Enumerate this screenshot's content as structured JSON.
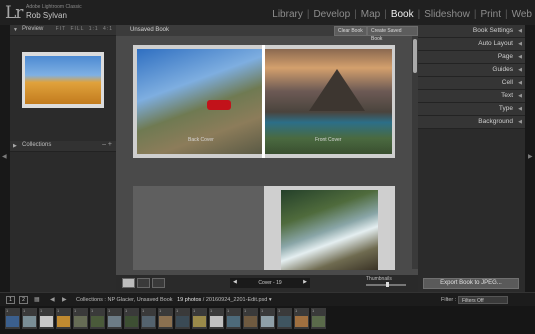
{
  "app": {
    "logo": "Lr",
    "app_name": "Adobe Lightroom Classic",
    "user_name": "Rob Sylvan"
  },
  "modules": [
    {
      "label": "Library",
      "active": false
    },
    {
      "label": "Develop",
      "active": false
    },
    {
      "label": "Map",
      "active": false
    },
    {
      "label": "Book",
      "active": true
    },
    {
      "label": "Slideshow",
      "active": false
    },
    {
      "label": "Print",
      "active": false
    },
    {
      "label": "Web",
      "active": false
    }
  ],
  "left_panel": {
    "preview_label": "Preview",
    "zoom_options": [
      "FIT",
      "FILL",
      "1:1",
      "4:1"
    ],
    "collections_label": "Collections",
    "collections_controls": "– +"
  },
  "center": {
    "book_title": "Unsaved Book",
    "clear_book": "Clear Book",
    "create_saved_book": "Create Saved Book",
    "back_cover_caption": "Back Cover",
    "front_cover_caption": "Front Cover",
    "page_nav": {
      "prev": "◀",
      "label": "Cover - 19",
      "next": "▶"
    },
    "thumbnails_label": "Thumbnails"
  },
  "right_panel": {
    "items": [
      "Book Settings",
      "Auto Layout",
      "Page",
      "Guides",
      "Cell",
      "Text",
      "Type",
      "Background"
    ],
    "export_button": "Export Book to JPEG..."
  },
  "filmstrip_bar": {
    "view1": "1",
    "view2": "2",
    "breadcrumb_prefix": "Collections : NP Glacier, Unsaved Book",
    "photo_count": "19 photos",
    "breadcrumb_suffix": "/ 20160924_2201-Edit.psd ▾",
    "filter_label": "Filter :",
    "filter_value": "Filters Off"
  },
  "filmstrip": {
    "frames": [
      {
        "num": "1",
        "color": "#3b5f8d"
      },
      {
        "num": "1",
        "color": "#7a8e96"
      },
      {
        "num": "1",
        "color": "#c9c9c9"
      },
      {
        "num": "1",
        "color": "#c08a30"
      },
      {
        "num": "1",
        "color": "#666c55"
      },
      {
        "num": "1",
        "color": "#4a5a3a"
      },
      {
        "num": "1",
        "color": "#6d7c86"
      },
      {
        "num": "1",
        "color": "#3d4f33"
      },
      {
        "num": "1",
        "color": "#54636e"
      },
      {
        "num": "1",
        "color": "#8a7050"
      },
      {
        "num": "1",
        "color": "#3a4a55"
      },
      {
        "num": "1",
        "color": "#9a8a4a"
      },
      {
        "num": "1",
        "color": "#c0c0c0"
      },
      {
        "num": "1",
        "color": "#4d6a7a"
      },
      {
        "num": "1",
        "color": "#6f5a40"
      },
      {
        "num": "1",
        "color": "#8fa0a8"
      },
      {
        "num": "1",
        "color": "#3f5560"
      },
      {
        "num": "1",
        "color": "#a07040"
      },
      {
        "num": "1",
        "color": "#5a6a4a"
      }
    ]
  }
}
